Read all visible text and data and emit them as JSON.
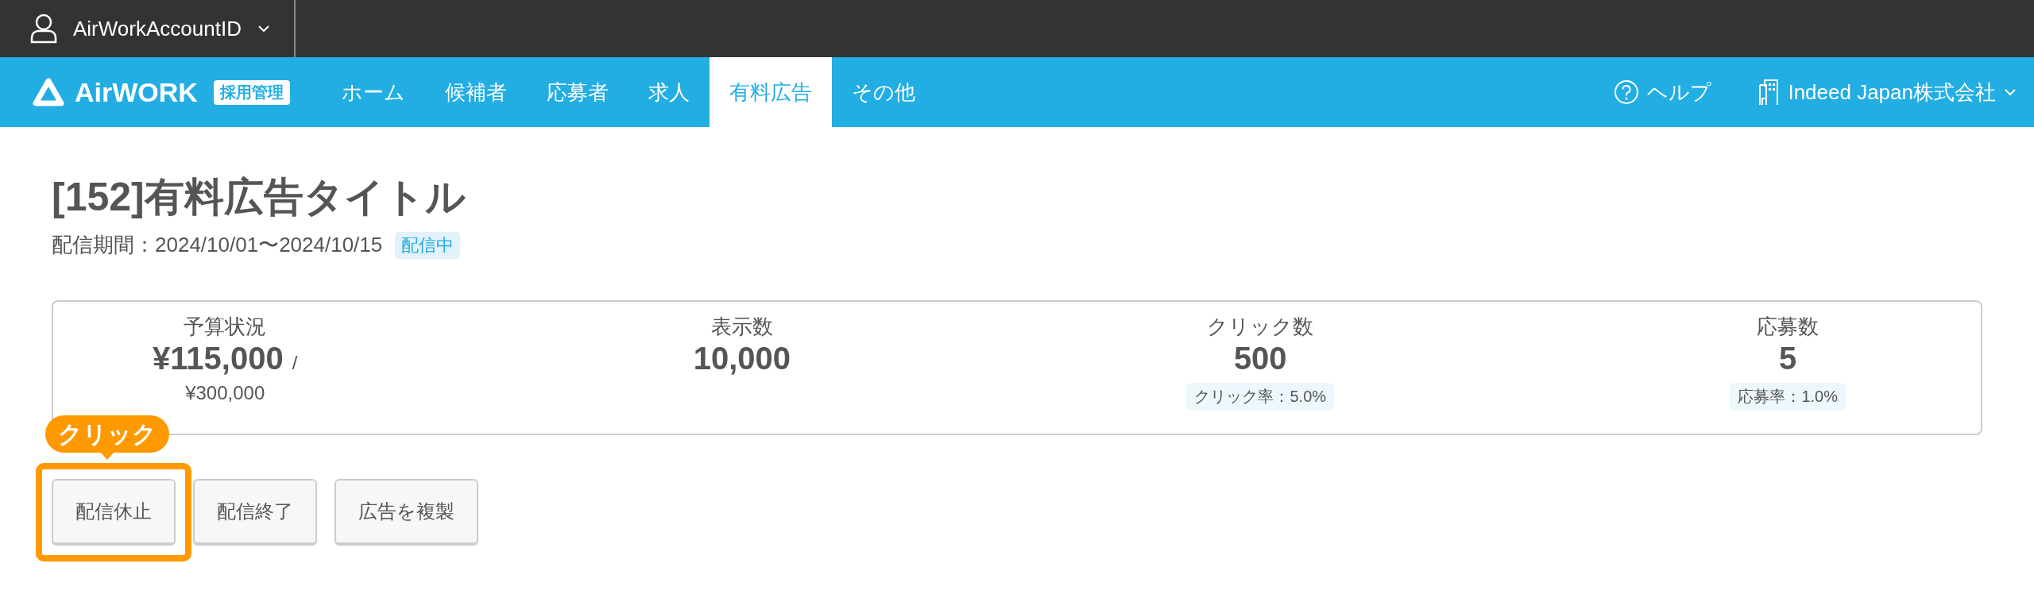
{
  "account_bar": {
    "account": "AirWorkAccountID"
  },
  "nav": {
    "logo": "AirWORK",
    "logo_badge": "採用管理",
    "items": [
      {
        "label": "ホーム",
        "selected": false
      },
      {
        "label": "候補者",
        "selected": false
      },
      {
        "label": "応募者",
        "selected": false
      },
      {
        "label": "求人",
        "selected": false
      },
      {
        "label": "有料広告",
        "selected": true
      },
      {
        "label": "その他",
        "selected": false
      }
    ],
    "help": "ヘルプ",
    "company": "Indeed Japan株式会社"
  },
  "page": {
    "title": "[152]有料広告タイトル",
    "period": "配信期間：2024/10/01〜2024/10/15",
    "status": "配信中"
  },
  "stats": [
    {
      "kind": "budget",
      "label": "予算状況",
      "value": "¥115,000",
      "separator": "/",
      "total": "¥300,000"
    },
    {
      "kind": "plain",
      "label": "表示数",
      "value": "10,000"
    },
    {
      "kind": "rate",
      "label": "クリック数",
      "value": "500",
      "rate": "クリック率：5.0%"
    },
    {
      "kind": "rate",
      "label": "応募数",
      "value": "5",
      "rate": "応募率：1.0%"
    }
  ],
  "actions": [
    {
      "label": "配信休止",
      "highlighted": true
    },
    {
      "label": "配信終了",
      "highlighted": false
    },
    {
      "label": "広告を複製",
      "highlighted": false
    }
  ],
  "callout": "クリック"
}
